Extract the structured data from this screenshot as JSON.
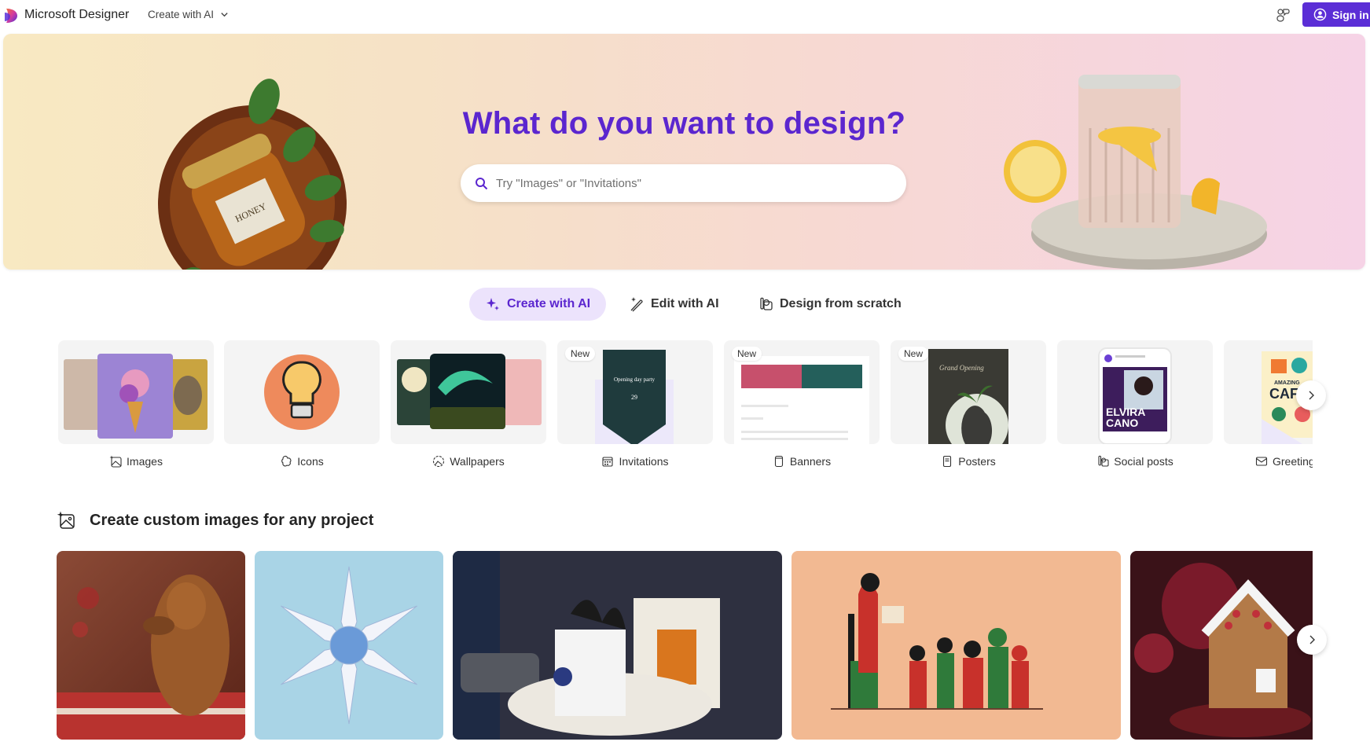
{
  "header": {
    "brand": "Microsoft Designer",
    "nav_create": "Create with AI",
    "feedback_icon": "feedback-icon",
    "signin_label": "Sign in"
  },
  "hero": {
    "title": "What do you want to design?",
    "search_placeholder": "Try \"Images\" or \"Invitations\"",
    "search_value": ""
  },
  "tabs": [
    {
      "label": "Create with AI",
      "icon": "sparkle-icon",
      "active": true
    },
    {
      "label": "Edit with AI",
      "icon": "magic-wand-icon",
      "active": false
    },
    {
      "label": "Design from scratch",
      "icon": "shapes-icon",
      "active": false
    }
  ],
  "categories": [
    {
      "label": "Images",
      "icon": "image-sparkle-icon",
      "new": false
    },
    {
      "label": "Icons",
      "icon": "icons-icon",
      "new": false
    },
    {
      "label": "Wallpapers",
      "icon": "wallpaper-icon",
      "new": false
    },
    {
      "label": "Invitations",
      "icon": "calendar-icon",
      "new": true,
      "badge": "New"
    },
    {
      "label": "Banners",
      "icon": "banner-icon",
      "new": true,
      "badge": "New"
    },
    {
      "label": "Posters",
      "icon": "poster-icon",
      "new": true,
      "badge": "New"
    },
    {
      "label": "Social posts",
      "icon": "social-post-icon",
      "new": false
    },
    {
      "label": "Greeting cards",
      "icon": "envelope-icon",
      "new": false
    }
  ],
  "thumb_text": {
    "invitation_title": "Opening day party",
    "invitation_date": "29",
    "poster_title": "Grand Opening",
    "social_name_1": "ELVIRA",
    "social_name_2": "CANO",
    "card_text_1": "AMAZING",
    "card_text_2": "CAF",
    "honey_label": "HONEY"
  },
  "section": {
    "title": "Create custom images for any project",
    "icon": "image-sparkle-icon"
  },
  "images": [
    {
      "alt": "Dachshund on holiday pillow"
    },
    {
      "alt": "Paper snowflake"
    },
    {
      "alt": "Gifts by fireplace"
    },
    {
      "alt": "Kwanzaa storytelling illustration"
    },
    {
      "alt": "Gingerbread house with teapot"
    }
  ],
  "colors": {
    "accent": "#5b26cf",
    "signin_bg": "#5b2ed6",
    "tab_active_bg": "#ece3fc"
  }
}
